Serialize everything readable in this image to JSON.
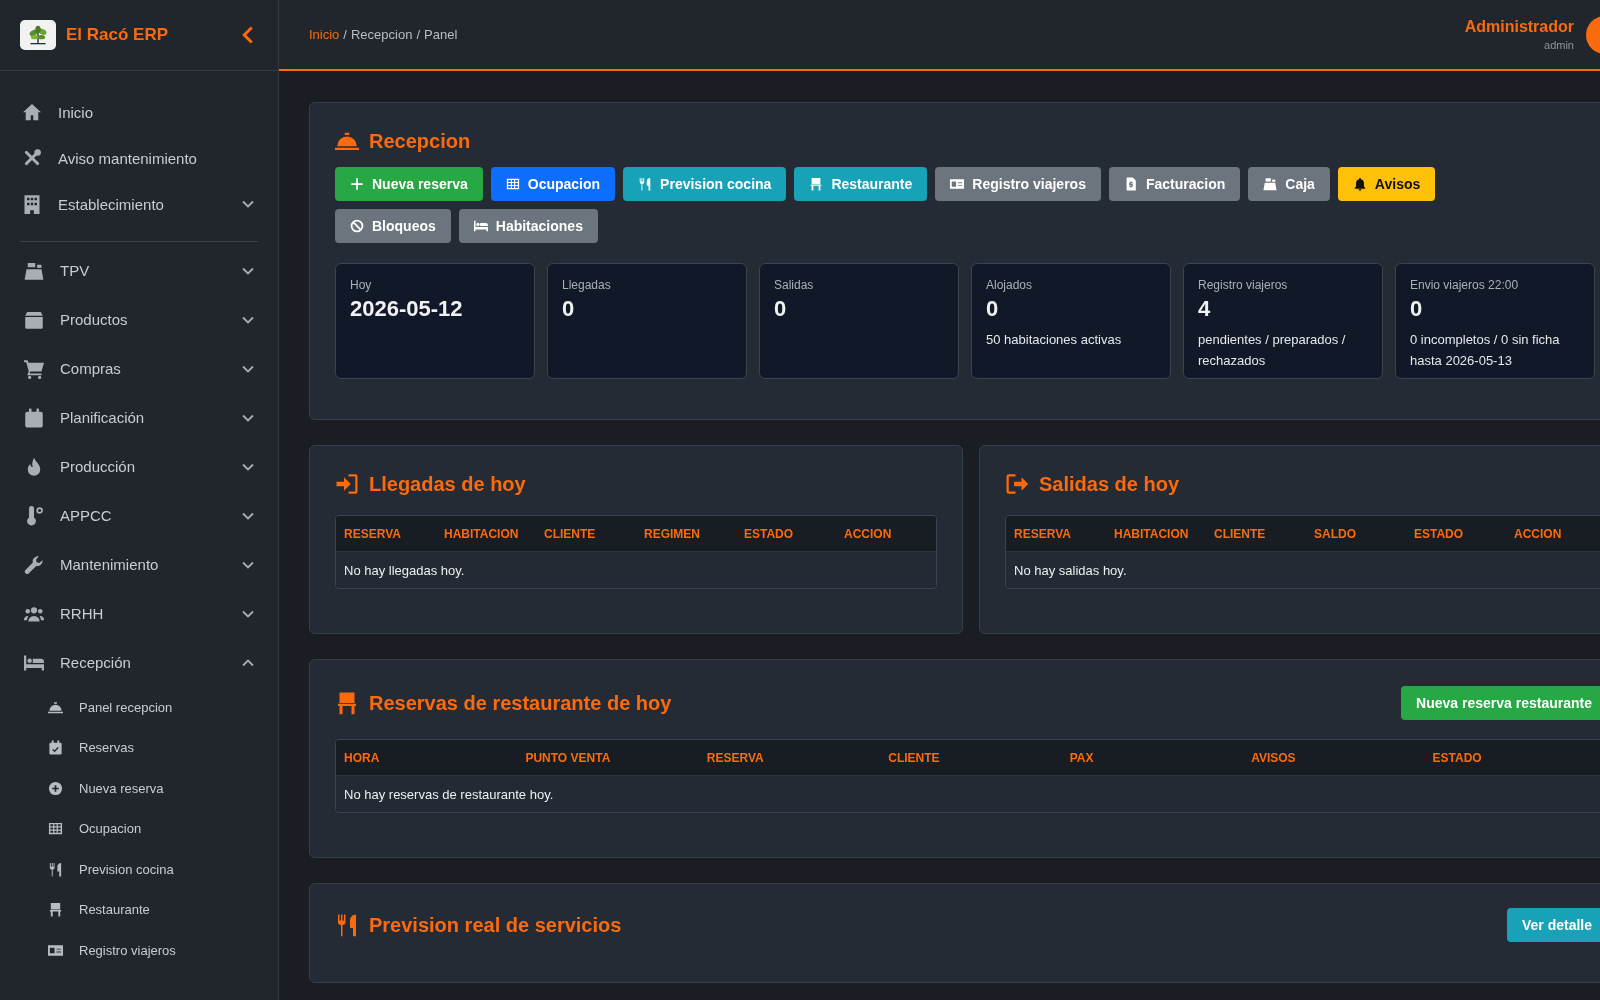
{
  "sidebar": {
    "brand": "El Racó ERP",
    "sections": [
      [
        {
          "label": "Inicio",
          "kind": "link"
        },
        {
          "label": "Aviso mantenimiento",
          "kind": "link"
        },
        {
          "label": "Establecimiento",
          "kind": "group",
          "expanded": false
        }
      ],
      [
        {
          "label": "TPV",
          "kind": "group",
          "expanded": false
        },
        {
          "label": "Productos",
          "kind": "group",
          "expanded": false
        },
        {
          "label": "Compras",
          "kind": "group",
          "expanded": false
        },
        {
          "label": "Planificación",
          "kind": "group",
          "expanded": false
        },
        {
          "label": "Producción",
          "kind": "group",
          "expanded": false
        },
        {
          "label": "APPCC",
          "kind": "group",
          "expanded": false
        },
        {
          "label": "Mantenimiento",
          "kind": "group",
          "expanded": false
        },
        {
          "label": "RRHH",
          "kind": "group",
          "expanded": false
        },
        {
          "label": "Recepción",
          "kind": "group",
          "expanded": true,
          "children": [
            {
              "label": "Panel recepcion"
            },
            {
              "label": "Reservas"
            },
            {
              "label": "Nueva reserva"
            },
            {
              "label": "Ocupacion"
            },
            {
              "label": "Prevision cocina"
            },
            {
              "label": "Restaurante"
            },
            {
              "label": "Registro viajeros"
            }
          ]
        }
      ]
    ]
  },
  "breadcrumb": {
    "items": [
      {
        "label": "Inicio",
        "kind": "link"
      },
      {
        "label": "Recepcion",
        "kind": "text"
      },
      {
        "label": "Panel",
        "kind": "text"
      }
    ],
    "separators": [
      "/",
      "/"
    ]
  },
  "user": {
    "name": "Administrador",
    "role": "admin"
  },
  "panel": {
    "title": "Recepcion",
    "buttons": [
      {
        "label": "Nueva reserva",
        "kind": "success"
      },
      {
        "label": "Ocupacion",
        "kind": "primary"
      },
      {
        "label": "Prevision cocina",
        "kind": "info"
      },
      {
        "label": "Restaurante",
        "kind": "info"
      },
      {
        "label": "Registro viajeros",
        "kind": "secondary"
      },
      {
        "label": "Facturacion",
        "kind": "secondary"
      },
      {
        "label": "Caja",
        "kind": "secondary"
      },
      {
        "label": "Avisos",
        "kind": "warning"
      },
      {
        "label": "Bloqueos",
        "kind": "secondary"
      },
      {
        "label": "Habitaciones",
        "kind": "secondary"
      }
    ],
    "stats": [
      {
        "label": "Hoy",
        "value": "2026-05-12"
      },
      {
        "label": "Llegadas",
        "value": "0"
      },
      {
        "label": "Salidas",
        "value": "0"
      },
      {
        "label": "Alojados",
        "value": "0",
        "note": "50 habitaciones activas"
      },
      {
        "label": "Registro viajeros",
        "value": "4",
        "note": "pendientes / preparados / rechazados"
      },
      {
        "label": "Envio viajeros 22:00",
        "value": "0",
        "note": "0 incompletos / 0 sin ficha hasta 2026-05-13"
      }
    ]
  },
  "arrivals": {
    "title": "Llegadas de hoy",
    "columns": [
      "RESERVA",
      "HABITACION",
      "CLIENTE",
      "REGIMEN",
      "ESTADO",
      "ACCION"
    ],
    "empty_message": "No hay llegadas hoy."
  },
  "departures": {
    "title": "Salidas de hoy",
    "columns": [
      "RESERVA",
      "HABITACION",
      "CLIENTE",
      "SALDO",
      "ESTADO",
      "ACCION"
    ],
    "empty_message": "No hay salidas hoy."
  },
  "restaurant": {
    "title": "Reservas de restaurante de hoy",
    "button": {
      "label": "Nueva reserva restaurante",
      "kind": "success"
    },
    "columns": [
      "HORA",
      "PUNTO VENTA",
      "RESERVA",
      "CLIENTE",
      "PAX",
      "AVISOS",
      "ESTADO"
    ],
    "empty_message": "No hay reservas de restaurante hoy."
  },
  "forecast": {
    "title": "Prevision real de servicios",
    "button": {
      "label": "Ver detalle",
      "kind": "info"
    }
  }
}
